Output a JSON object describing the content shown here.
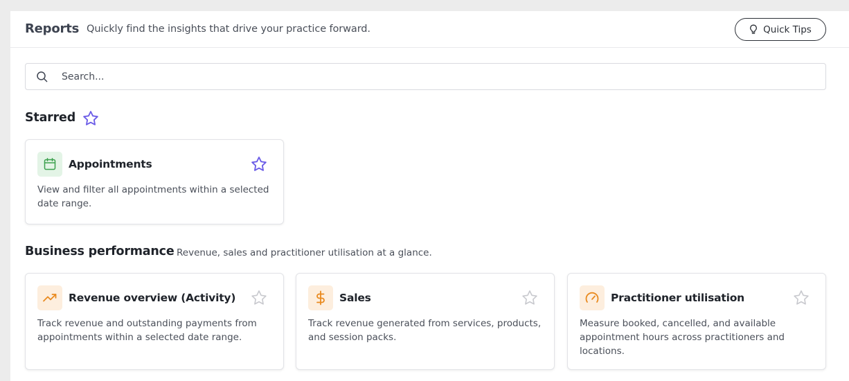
{
  "header": {
    "title": "Reports",
    "subtitle": "Quickly find the insights that drive your practice forward.",
    "quick_tips_label": "Quick Tips"
  },
  "search": {
    "placeholder": "Search...",
    "value": ""
  },
  "starred": {
    "title": "Starred",
    "cards": [
      {
        "title": "Appointments",
        "description": "View and filter all appointments within a selected date range.",
        "icon": "calendar-icon",
        "starred": true
      }
    ]
  },
  "business_performance": {
    "title": "Business performance",
    "subtitle": "Revenue, sales and practitioner utilisation at a glance.",
    "cards": [
      {
        "title": "Revenue overview (Activity)",
        "description": "Track revenue and outstanding payments from appointments within a selected date range.",
        "icon": "trending-up-icon",
        "starred": false
      },
      {
        "title": "Sales",
        "description": "Track revenue generated from services, products, and session packs.",
        "icon": "dollar-icon",
        "starred": false
      },
      {
        "title": "Practitioner utilisation",
        "description": "Measure booked, cancelled, and available appointment hours across practitioners and locations.",
        "icon": "gauge-icon",
        "starred": false
      }
    ]
  },
  "colors": {
    "accent_purple": "#6b5ce7",
    "green": "#3aa04c",
    "orange": "#e98a1f",
    "star_inactive": "#c8c9ce"
  }
}
